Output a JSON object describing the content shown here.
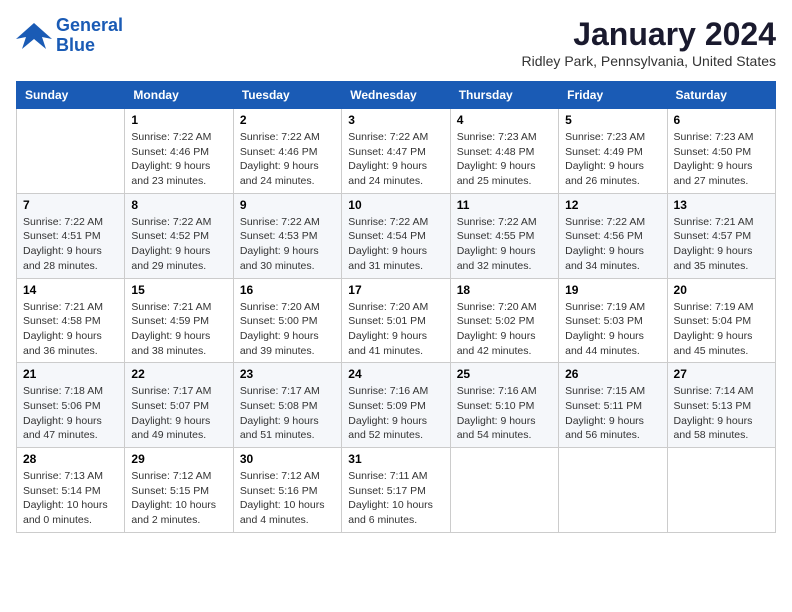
{
  "header": {
    "logo_line1": "General",
    "logo_line2": "Blue",
    "month_title": "January 2024",
    "location": "Ridley Park, Pennsylvania, United States"
  },
  "days_of_week": [
    "Sunday",
    "Monday",
    "Tuesday",
    "Wednesday",
    "Thursday",
    "Friday",
    "Saturday"
  ],
  "weeks": [
    [
      {
        "day": "",
        "info": ""
      },
      {
        "day": "1",
        "info": "Sunrise: 7:22 AM\nSunset: 4:46 PM\nDaylight: 9 hours\nand 23 minutes."
      },
      {
        "day": "2",
        "info": "Sunrise: 7:22 AM\nSunset: 4:46 PM\nDaylight: 9 hours\nand 24 minutes."
      },
      {
        "day": "3",
        "info": "Sunrise: 7:22 AM\nSunset: 4:47 PM\nDaylight: 9 hours\nand 24 minutes."
      },
      {
        "day": "4",
        "info": "Sunrise: 7:23 AM\nSunset: 4:48 PM\nDaylight: 9 hours\nand 25 minutes."
      },
      {
        "day": "5",
        "info": "Sunrise: 7:23 AM\nSunset: 4:49 PM\nDaylight: 9 hours\nand 26 minutes."
      },
      {
        "day": "6",
        "info": "Sunrise: 7:23 AM\nSunset: 4:50 PM\nDaylight: 9 hours\nand 27 minutes."
      }
    ],
    [
      {
        "day": "7",
        "info": "Sunrise: 7:22 AM\nSunset: 4:51 PM\nDaylight: 9 hours\nand 28 minutes."
      },
      {
        "day": "8",
        "info": "Sunrise: 7:22 AM\nSunset: 4:52 PM\nDaylight: 9 hours\nand 29 minutes."
      },
      {
        "day": "9",
        "info": "Sunrise: 7:22 AM\nSunset: 4:53 PM\nDaylight: 9 hours\nand 30 minutes."
      },
      {
        "day": "10",
        "info": "Sunrise: 7:22 AM\nSunset: 4:54 PM\nDaylight: 9 hours\nand 31 minutes."
      },
      {
        "day": "11",
        "info": "Sunrise: 7:22 AM\nSunset: 4:55 PM\nDaylight: 9 hours\nand 32 minutes."
      },
      {
        "day": "12",
        "info": "Sunrise: 7:22 AM\nSunset: 4:56 PM\nDaylight: 9 hours\nand 34 minutes."
      },
      {
        "day": "13",
        "info": "Sunrise: 7:21 AM\nSunset: 4:57 PM\nDaylight: 9 hours\nand 35 minutes."
      }
    ],
    [
      {
        "day": "14",
        "info": "Sunrise: 7:21 AM\nSunset: 4:58 PM\nDaylight: 9 hours\nand 36 minutes."
      },
      {
        "day": "15",
        "info": "Sunrise: 7:21 AM\nSunset: 4:59 PM\nDaylight: 9 hours\nand 38 minutes."
      },
      {
        "day": "16",
        "info": "Sunrise: 7:20 AM\nSunset: 5:00 PM\nDaylight: 9 hours\nand 39 minutes."
      },
      {
        "day": "17",
        "info": "Sunrise: 7:20 AM\nSunset: 5:01 PM\nDaylight: 9 hours\nand 41 minutes."
      },
      {
        "day": "18",
        "info": "Sunrise: 7:20 AM\nSunset: 5:02 PM\nDaylight: 9 hours\nand 42 minutes."
      },
      {
        "day": "19",
        "info": "Sunrise: 7:19 AM\nSunset: 5:03 PM\nDaylight: 9 hours\nand 44 minutes."
      },
      {
        "day": "20",
        "info": "Sunrise: 7:19 AM\nSunset: 5:04 PM\nDaylight: 9 hours\nand 45 minutes."
      }
    ],
    [
      {
        "day": "21",
        "info": "Sunrise: 7:18 AM\nSunset: 5:06 PM\nDaylight: 9 hours\nand 47 minutes."
      },
      {
        "day": "22",
        "info": "Sunrise: 7:17 AM\nSunset: 5:07 PM\nDaylight: 9 hours\nand 49 minutes."
      },
      {
        "day": "23",
        "info": "Sunrise: 7:17 AM\nSunset: 5:08 PM\nDaylight: 9 hours\nand 51 minutes."
      },
      {
        "day": "24",
        "info": "Sunrise: 7:16 AM\nSunset: 5:09 PM\nDaylight: 9 hours\nand 52 minutes."
      },
      {
        "day": "25",
        "info": "Sunrise: 7:16 AM\nSunset: 5:10 PM\nDaylight: 9 hours\nand 54 minutes."
      },
      {
        "day": "26",
        "info": "Sunrise: 7:15 AM\nSunset: 5:11 PM\nDaylight: 9 hours\nand 56 minutes."
      },
      {
        "day": "27",
        "info": "Sunrise: 7:14 AM\nSunset: 5:13 PM\nDaylight: 9 hours\nand 58 minutes."
      }
    ],
    [
      {
        "day": "28",
        "info": "Sunrise: 7:13 AM\nSunset: 5:14 PM\nDaylight: 10 hours\nand 0 minutes."
      },
      {
        "day": "29",
        "info": "Sunrise: 7:12 AM\nSunset: 5:15 PM\nDaylight: 10 hours\nand 2 minutes."
      },
      {
        "day": "30",
        "info": "Sunrise: 7:12 AM\nSunset: 5:16 PM\nDaylight: 10 hours\nand 4 minutes."
      },
      {
        "day": "31",
        "info": "Sunrise: 7:11 AM\nSunset: 5:17 PM\nDaylight: 10 hours\nand 6 minutes."
      },
      {
        "day": "",
        "info": ""
      },
      {
        "day": "",
        "info": ""
      },
      {
        "day": "",
        "info": ""
      }
    ]
  ]
}
